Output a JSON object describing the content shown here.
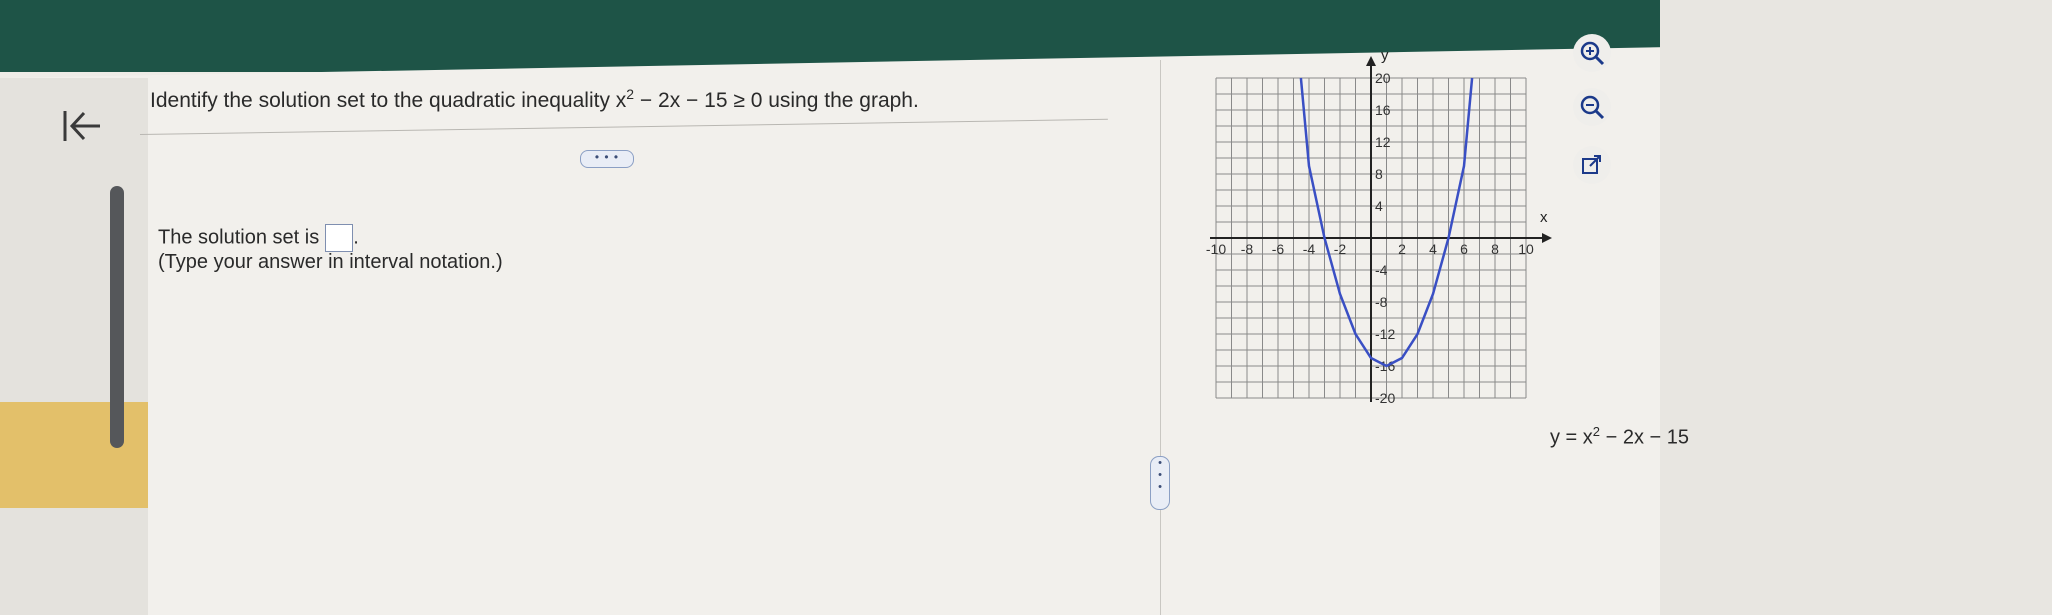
{
  "question": {
    "prefix": "Identify the solution set to the quadratic inequality x",
    "exponent": "2",
    "suffix": " − 2x − 15 ≥ 0 using the graph."
  },
  "dots_label": "• • •",
  "answer": {
    "prompt": "The solution set is",
    "value": "",
    "period": ".",
    "hint": "(Type your answer in interval notation.)"
  },
  "equation": {
    "prefix": "y = x",
    "exponent": "2",
    "suffix": " − 2x − 15"
  },
  "tools": {
    "zoom_in": "zoom-in-icon",
    "zoom_out": "zoom-out-icon",
    "external": "external-link-icon"
  },
  "chart_data": {
    "type": "line",
    "x_label": "x",
    "y_label": "y",
    "x_ticks": [
      "-10",
      "-8",
      "-6",
      "-4",
      "-2",
      "2",
      "4",
      "6",
      "8",
      "10"
    ],
    "y_ticks": [
      "20",
      "16",
      "12",
      "8",
      "4",
      "-4",
      "-8",
      "-12",
      "-16",
      "-20"
    ],
    "xlim": [
      -10,
      10
    ],
    "ylim": [
      -20,
      20
    ],
    "grid": true,
    "series": [
      {
        "color": "#3a4fc4",
        "x": [
          -4.52,
          -4,
          -3,
          -2,
          -1,
          0,
          1,
          2,
          3,
          4,
          5,
          6,
          6.52
        ],
        "y": [
          20,
          9,
          0,
          -7,
          -12,
          -15,
          -16,
          -15,
          -12,
          -7,
          0,
          9,
          20
        ]
      }
    ]
  }
}
